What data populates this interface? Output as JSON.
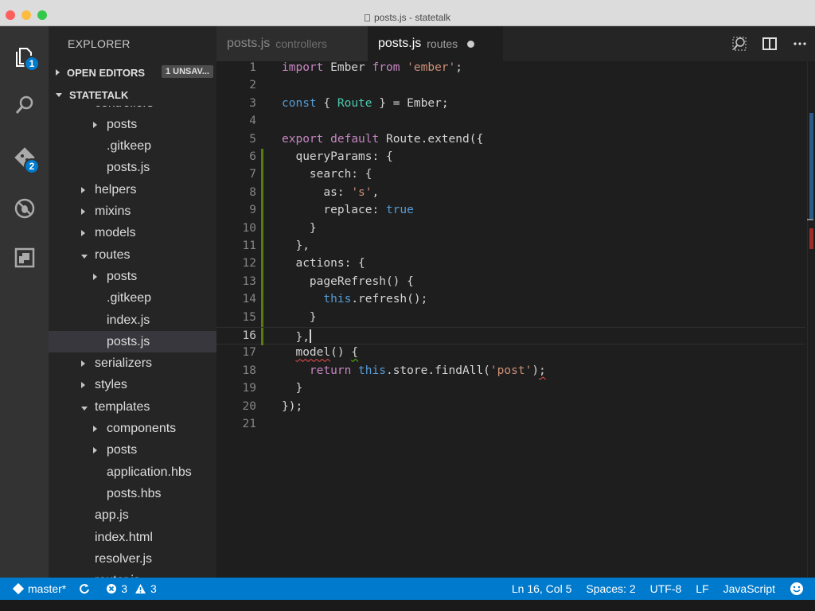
{
  "window": {
    "title": "posts.js - statetalk",
    "colors": {
      "close": "#fc605c",
      "minimize": "#fdbc40",
      "maximize": "#34c84a"
    }
  },
  "activity_bar": {
    "explorer_badge": "1",
    "git_badge": "2"
  },
  "sidebar": {
    "title": "EXPLORER",
    "open_editors_label": "OPEN EDITORS",
    "open_editors_badge": "1 UNSAV...",
    "project_label": "STATETALK",
    "tree": [
      {
        "label": "controllers",
        "indent": 2,
        "arrow": "none"
      },
      {
        "label": "posts",
        "indent": 3,
        "arrow": "right"
      },
      {
        "label": ".gitkeep",
        "indent": 3,
        "arrow": "none"
      },
      {
        "label": "posts.js",
        "indent": 3,
        "arrow": "none"
      },
      {
        "label": "helpers",
        "indent": 2,
        "arrow": "right"
      },
      {
        "label": "mixins",
        "indent": 2,
        "arrow": "right"
      },
      {
        "label": "models",
        "indent": 2,
        "arrow": "right"
      },
      {
        "label": "routes",
        "indent": 2,
        "arrow": "down"
      },
      {
        "label": "posts",
        "indent": 3,
        "arrow": "right"
      },
      {
        "label": ".gitkeep",
        "indent": 3,
        "arrow": "none"
      },
      {
        "label": "index.js",
        "indent": 3,
        "arrow": "none"
      },
      {
        "label": "posts.js",
        "indent": 3,
        "arrow": "none",
        "selected": true
      },
      {
        "label": "serializers",
        "indent": 2,
        "arrow": "right"
      },
      {
        "label": "styles",
        "indent": 2,
        "arrow": "right"
      },
      {
        "label": "templates",
        "indent": 2,
        "arrow": "down"
      },
      {
        "label": "components",
        "indent": 3,
        "arrow": "right"
      },
      {
        "label": "posts",
        "indent": 3,
        "arrow": "right"
      },
      {
        "label": "application.hbs",
        "indent": 3,
        "arrow": "none"
      },
      {
        "label": "posts.hbs",
        "indent": 3,
        "arrow": "none"
      },
      {
        "label": "app.js",
        "indent": 2,
        "arrow": "none"
      },
      {
        "label": "index.html",
        "indent": 2,
        "arrow": "none"
      },
      {
        "label": "resolver.js",
        "indent": 2,
        "arrow": "none"
      },
      {
        "label": "router.js",
        "indent": 2,
        "arrow": "none"
      }
    ]
  },
  "tabs": [
    {
      "name": "posts.js",
      "description": "controllers",
      "active": false
    },
    {
      "name": "posts.js",
      "description": "routes",
      "active": true,
      "dirty": true
    }
  ],
  "editor": {
    "current_line": 16,
    "lines": [
      {
        "n": "1",
        "tokens": [
          [
            "k",
            "import"
          ],
          [
            "p",
            " Ember "
          ],
          [
            "k",
            "from"
          ],
          [
            "p",
            " "
          ],
          [
            "s",
            "'ember'"
          ],
          [
            "p",
            ";"
          ]
        ]
      },
      {
        "n": "2",
        "tokens": []
      },
      {
        "n": "3",
        "tokens": [
          [
            "b",
            "const"
          ],
          [
            "p",
            " { "
          ],
          [
            "t",
            "Route"
          ],
          [
            "p",
            " } = Ember;"
          ]
        ]
      },
      {
        "n": "4",
        "tokens": []
      },
      {
        "n": "5",
        "tokens": [
          [
            "k",
            "export"
          ],
          [
            "p",
            " "
          ],
          [
            "k",
            "default"
          ],
          [
            "p",
            " Route.extend({"
          ]
        ]
      },
      {
        "n": "6",
        "tokens": [
          [
            "p",
            "  queryParams: {"
          ]
        ],
        "modified": true
      },
      {
        "n": "7",
        "tokens": [
          [
            "p",
            "    search: {"
          ]
        ],
        "modified": true
      },
      {
        "n": "8",
        "tokens": [
          [
            "p",
            "      as: "
          ],
          [
            "s",
            "'s'"
          ],
          [
            "p",
            ","
          ]
        ],
        "modified": true
      },
      {
        "n": "9",
        "tokens": [
          [
            "p",
            "      replace: "
          ],
          [
            "b",
            "true"
          ]
        ],
        "modified": true
      },
      {
        "n": "10",
        "tokens": [
          [
            "p",
            "    }"
          ]
        ],
        "modified": true
      },
      {
        "n": "11",
        "tokens": [
          [
            "p",
            "  },"
          ]
        ],
        "modified": true
      },
      {
        "n": "12",
        "tokens": [
          [
            "p",
            "  actions: {"
          ]
        ],
        "modified": true
      },
      {
        "n": "13",
        "tokens": [
          [
            "p",
            "    pageRefresh() {"
          ]
        ],
        "modified": true
      },
      {
        "n": "14",
        "tokens": [
          [
            "p",
            "      "
          ],
          [
            "b",
            "this"
          ],
          [
            "p",
            ".refresh();"
          ]
        ],
        "modified": true
      },
      {
        "n": "15",
        "tokens": [
          [
            "p",
            "    }"
          ]
        ],
        "modified": true
      },
      {
        "n": "16",
        "tokens": [
          [
            "p",
            "  },"
          ],
          [
            "cursor",
            ""
          ]
        ],
        "modified": true
      },
      {
        "n": "17",
        "tokens": [
          [
            "p",
            "  "
          ],
          [
            "squig",
            "model"
          ],
          [
            "p",
            "() "
          ],
          [
            "squigg",
            "{"
          ]
        ]
      },
      {
        "n": "18",
        "tokens": [
          [
            "p",
            "    "
          ],
          [
            "k",
            "return"
          ],
          [
            "p",
            " "
          ],
          [
            "b",
            "this"
          ],
          [
            "p",
            ".store.findAll("
          ],
          [
            "s",
            "'post'"
          ],
          [
            "p",
            ")"
          ],
          [
            "squig",
            ";"
          ]
        ]
      },
      {
        "n": "19",
        "tokens": [
          [
            "p",
            "  }"
          ]
        ]
      },
      {
        "n": "20",
        "tokens": [
          [
            "p",
            "});"
          ]
        ]
      },
      {
        "n": "21",
        "tokens": []
      }
    ]
  },
  "statusbar": {
    "branch": "master*",
    "errors": "3",
    "warnings": "3",
    "position": "Ln 16, Col 5",
    "spaces": "Spaces: 2",
    "encoding": "UTF-8",
    "eol": "LF",
    "language": "JavaScript"
  }
}
